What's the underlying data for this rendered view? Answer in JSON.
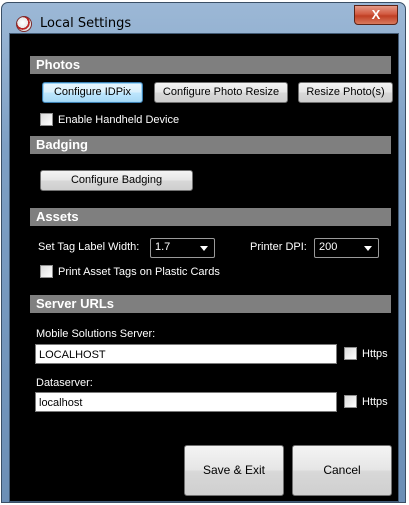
{
  "window": {
    "title": "Local Settings",
    "close_glyph": "X"
  },
  "photos": {
    "header": "Photos",
    "configure_idpix": "Configure IDPix",
    "configure_photo_resize": "Configure Photo Resize",
    "resize_photos": "Resize Photo(s)",
    "enable_handheld": "Enable Handheld Device"
  },
  "badging": {
    "header": "Badging",
    "configure_badging": "Configure Badging"
  },
  "assets": {
    "header": "Assets",
    "tag_label_width_label": "Set Tag Label Width:",
    "tag_label_width_value": "1.7",
    "printer_dpi_label": "Printer DPI:",
    "printer_dpi_value": "200",
    "print_plastic": "Print Asset Tags on Plastic Cards"
  },
  "server_urls": {
    "header": "Server URLs",
    "mobile_label": "Mobile Solutions Server:",
    "mobile_value": "LOCALHOST",
    "mobile_https": "Https",
    "dataserver_label": "Dataserver:",
    "dataserver_value": "localhost",
    "dataserver_https": "Https"
  },
  "actions": {
    "save_exit": "Save & Exit",
    "cancel": "Cancel"
  }
}
